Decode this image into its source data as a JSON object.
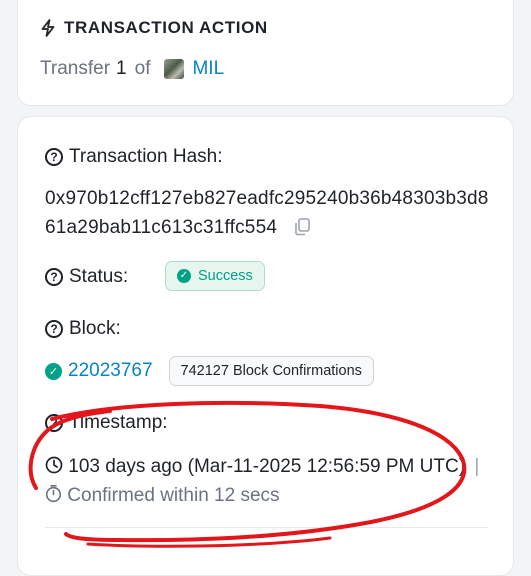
{
  "action": {
    "title": "TRANSACTION ACTION",
    "transfer_word": "Transfer",
    "transfer_amount": "1",
    "of_word": "of",
    "token_symbol": "MIL"
  },
  "details": {
    "hash_label": "Transaction Hash:",
    "hash_value": "0x970b12cff127eb827eadfc295240b36b48303b3d861a29bab11c613c31ffc554",
    "status_label": "Status:",
    "status_value": "Success",
    "block_label": "Block:",
    "block_number": "22023767",
    "block_confirmations": "742127 Block Confirmations",
    "timestamp_label": "Timestamp:",
    "timestamp_value": "103 days ago (Mar-11-2025 12:56:59 PM UTC)",
    "timestamp_separator": "|",
    "confirmed_text": "Confirmed within 12 secs"
  },
  "colors": {
    "link": "#0784c3",
    "success": "#00a186",
    "annotation": "#e3161b"
  },
  "icons": [
    "lightning-icon",
    "token-avatar-icon",
    "question-circle-icon",
    "copy-icon",
    "check-circle-icon",
    "clock-icon",
    "timer-icon"
  ]
}
